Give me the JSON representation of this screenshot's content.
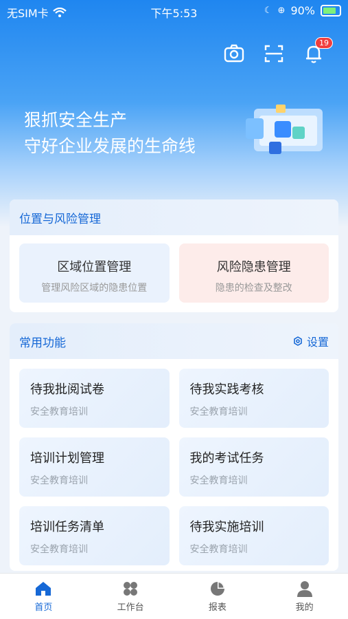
{
  "status": {
    "carrier": "无SIM卡",
    "time": "下午5:53",
    "battery": "90%"
  },
  "header": {
    "notification_count": "19"
  },
  "banner": {
    "line1": "狠抓安全生产",
    "line2": "守好企业发展的生命线"
  },
  "risk_section": {
    "title": "位置与风险管理",
    "tiles": [
      {
        "title": "区域位置管理",
        "subtitle": "管理风险区域的隐患位置"
      },
      {
        "title": "风险隐患管理",
        "subtitle": "隐患的检查及整改"
      }
    ]
  },
  "common_section": {
    "title": "常用功能",
    "settings_label": "设置",
    "tiles": [
      {
        "title": "待我批阅试卷",
        "subtitle": "安全教育培训"
      },
      {
        "title": "待我实践考核",
        "subtitle": "安全教育培训"
      },
      {
        "title": "培训计划管理",
        "subtitle": "安全教育培训"
      },
      {
        "title": "我的考试任务",
        "subtitle": "安全教育培训"
      },
      {
        "title": "培训任务清单",
        "subtitle": "安全教育培训"
      },
      {
        "title": "待我实施培训",
        "subtitle": "安全教育培训"
      }
    ]
  },
  "tabbar": {
    "items": [
      {
        "label": "首页",
        "icon": "home-icon"
      },
      {
        "label": "工作台",
        "icon": "apps-icon"
      },
      {
        "label": "报表",
        "icon": "pie-chart-icon"
      },
      {
        "label": "我的",
        "icon": "user-icon"
      }
    ]
  },
  "colors": {
    "primary": "#1668d6",
    "badge": "#f03e3e",
    "hero_top": "#1f86f0"
  }
}
